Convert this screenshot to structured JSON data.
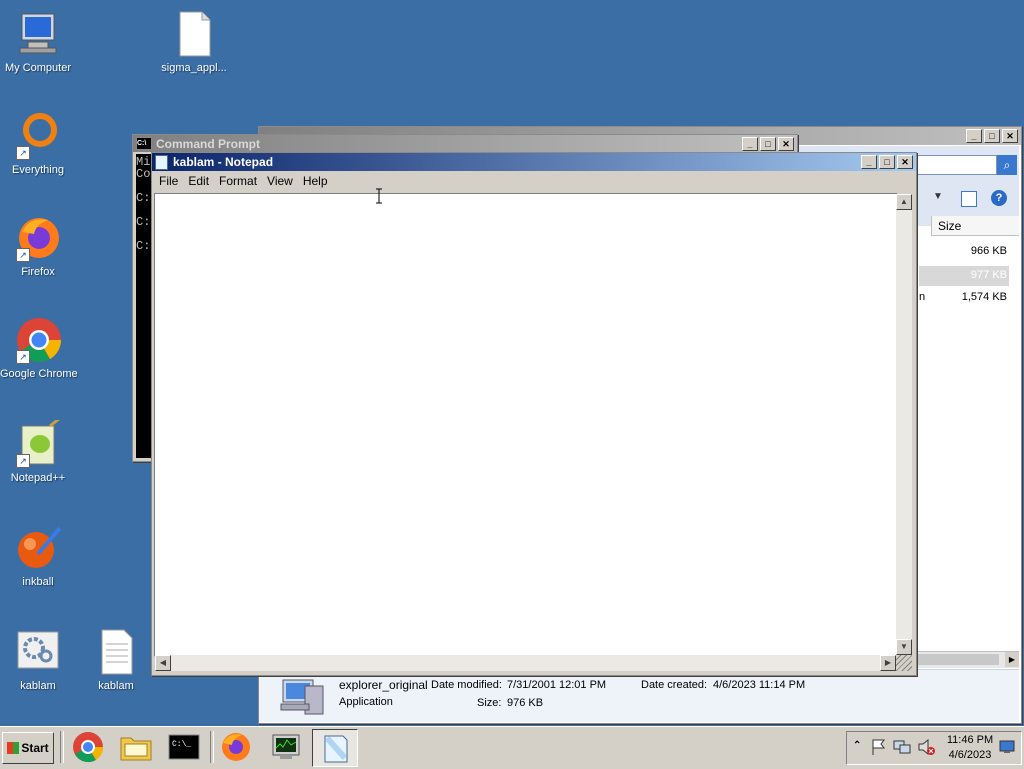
{
  "desktop": {
    "icons": [
      {
        "label": "My Computer"
      },
      {
        "label": "sigma_appl..."
      },
      {
        "label": "Everything"
      },
      {
        "label": "Firefox"
      },
      {
        "label": "Google Chrome"
      },
      {
        "label": "Notepad++"
      },
      {
        "label": "inkball"
      },
      {
        "label": "kablam"
      },
      {
        "label": "kablam"
      }
    ]
  },
  "cmd_window": {
    "title": "Command Prompt",
    "lines": [
      "Mi",
      "Co",
      "C:",
      "C:",
      "C:"
    ]
  },
  "explorer_window": {
    "size_header": "Size",
    "sizes": [
      "966 KB",
      "977 KB",
      "1,574 KB"
    ],
    "row3_fragment": "n",
    "details": {
      "name": "explorer_original",
      "type": "Application",
      "date_modified_label": "Date modified:",
      "date_modified": "7/31/2001 12:01 PM",
      "date_created_label": "Date created:",
      "date_created": "4/6/2023 11:14 PM",
      "size_label": "Size:",
      "size": "976 KB"
    }
  },
  "notepad": {
    "title": "kablam - Notepad",
    "menu": [
      "File",
      "Edit",
      "Format",
      "View",
      "Help"
    ],
    "content": ""
  },
  "taskbar": {
    "start_label": "Start",
    "clock_time": "11:46 PM",
    "clock_date": "4/6/2023"
  },
  "colors": {
    "desktop": "#3a6ea5",
    "title_active": "#0a246a"
  }
}
